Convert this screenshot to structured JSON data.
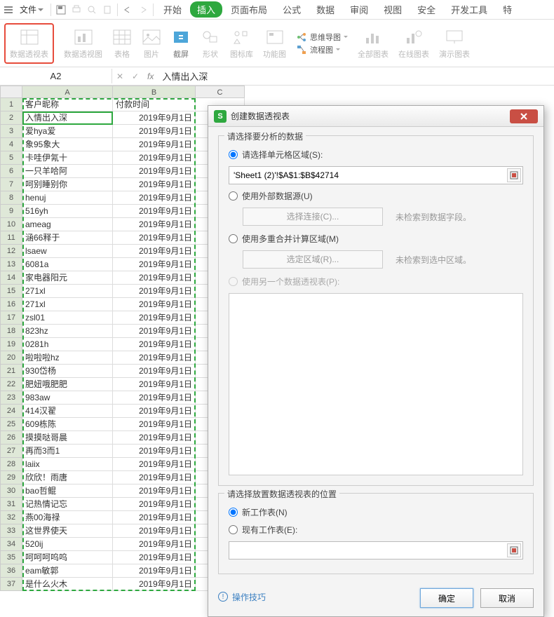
{
  "menubar": {
    "file": "文件",
    "tabs": [
      "开始",
      "插入",
      "页面布局",
      "公式",
      "数据",
      "审阅",
      "视图",
      "安全",
      "开发工具",
      "特"
    ],
    "active_tab": "插入"
  },
  "ribbon": {
    "pivot_table": "数据透视表",
    "pivot_chart": "数据透视图",
    "table": "表格",
    "picture": "图片",
    "screenshot": "截屏",
    "shape": "形状",
    "icon_lib": "图标库",
    "func_chart": "功能图",
    "mindmap": "思维导图",
    "flowchart": "流程图",
    "all_chart": "全部图表",
    "online_chart": "在线图表",
    "demo_chart": "演示图表"
  },
  "formula": {
    "name_box": "A2",
    "fx": "fx",
    "text": "入情出入深"
  },
  "columns": {
    "A": "A",
    "B": "B",
    "C": "C"
  },
  "header_row": {
    "A": "客户昵称",
    "B": "付款时间"
  },
  "rows": [
    {
      "n": "1",
      "A": "客户昵称",
      "B": "付款时间",
      "header": true
    },
    {
      "n": "2",
      "A": "入情出入深",
      "B": "2019年9月1日",
      "active": true
    },
    {
      "n": "3",
      "A": "爱hya爱",
      "B": "2019年9月1日"
    },
    {
      "n": "4",
      "A": "象95象大",
      "B": "2019年9月1日"
    },
    {
      "n": "5",
      "A": "卡哇伊氝十",
      "B": "2019年9月1日"
    },
    {
      "n": "6",
      "A": "一只羊哈阿",
      "B": "2019年9月1日"
    },
    {
      "n": "7",
      "A": "呵别睡别你",
      "B": "2019年9月1日"
    },
    {
      "n": "8",
      "A": "henuj",
      "B": "2019年9月1日"
    },
    {
      "n": "9",
      "A": "516yh",
      "B": "2019年9月1日"
    },
    {
      "n": "10",
      "A": "ameag",
      "B": "2019年9月1日"
    },
    {
      "n": "11",
      "A": "涵66释于",
      "B": "2019年9月1日"
    },
    {
      "n": "12",
      "A": "lsaew",
      "B": "2019年9月1日"
    },
    {
      "n": "13",
      "A": "6081a",
      "B": "2019年9月1日"
    },
    {
      "n": "14",
      "A": "家电器阳元",
      "B": "2019年9月1日"
    },
    {
      "n": "15",
      "A": "271xl",
      "B": "2019年9月1日"
    },
    {
      "n": "16",
      "A": "271xl",
      "B": "2019年9月1日"
    },
    {
      "n": "17",
      "A": "zsl01",
      "B": "2019年9月1日"
    },
    {
      "n": "18",
      "A": "823hz",
      "B": "2019年9月1日"
    },
    {
      "n": "19",
      "A": "0281h",
      "B": "2019年9月1日"
    },
    {
      "n": "20",
      "A": "啦啦啦hz",
      "B": "2019年9月1日"
    },
    {
      "n": "21",
      "A": "930岱杨",
      "B": "2019年9月1日"
    },
    {
      "n": "22",
      "A": "肥妞哦肥肥",
      "B": "2019年9月1日"
    },
    {
      "n": "23",
      "A": "983aw",
      "B": "2019年9月1日"
    },
    {
      "n": "24",
      "A": "414汉翟",
      "B": "2019年9月1日"
    },
    {
      "n": "25",
      "A": "609栋陈",
      "B": "2019年9月1日"
    },
    {
      "n": "26",
      "A": "摸摸哒哥晨",
      "B": "2019年9月1日"
    },
    {
      "n": "27",
      "A": "再而3而1",
      "B": "2019年9月1日"
    },
    {
      "n": "28",
      "A": "laiix",
      "B": "2019年9月1日"
    },
    {
      "n": "29",
      "A": "欣欣！雨唐",
      "B": "2019年9月1日"
    },
    {
      "n": "30",
      "A": "bao哲鲲",
      "B": "2019年9月1日"
    },
    {
      "n": "31",
      "A": "记热情记忘",
      "B": "2019年9月1日"
    },
    {
      "n": "32",
      "A": "燕00海禄",
      "B": "2019年9月1日"
    },
    {
      "n": "33",
      "A": "这世界使天",
      "B": "2019年9月1日"
    },
    {
      "n": "34",
      "A": "520ij",
      "B": "2019年9月1日"
    },
    {
      "n": "35",
      "A": "呵呵呵呜呜",
      "B": "2019年9月1日"
    },
    {
      "n": "36",
      "A": "eam敏郭",
      "B": "2019年9月1日"
    },
    {
      "n": "37",
      "A": "是什么火木",
      "B": "2019年9月1日"
    }
  ],
  "dialog": {
    "title": "创建数据透视表",
    "section1_title": "请选择要分析的数据",
    "radio_range": "请选择单元格区域(S):",
    "range_value": "'Sheet1 (2)'!$A$1:$B$42714",
    "radio_ext": "使用外部数据源(U)",
    "btn_conn": "选择连接(C)...",
    "hint_conn": "未检索到数据字段。",
    "radio_multi": "使用多重合并计算区域(M)",
    "btn_area": "选定区域(R)...",
    "hint_area": "未检索到选中区域。",
    "radio_another": "使用另一个数据透视表(P):",
    "section2_title": "请选择放置数据透视表的位置",
    "radio_newsheet": "新工作表(N)",
    "radio_existing": "现有工作表(E):",
    "op_tip": "操作技巧",
    "ok": "确定",
    "cancel": "取消"
  }
}
